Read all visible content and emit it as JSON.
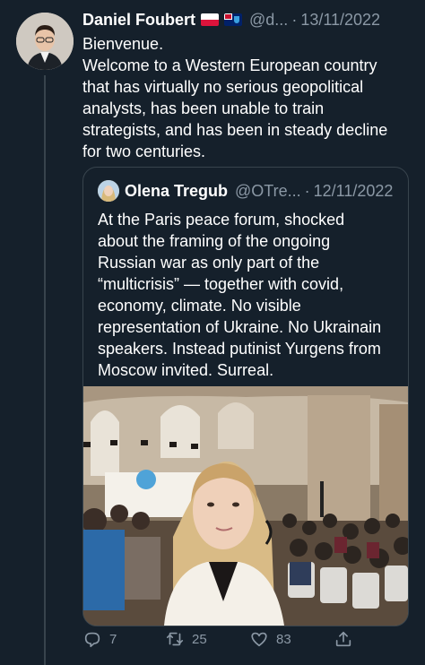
{
  "tweet": {
    "author_name": "Daniel Foubert",
    "author_flags": [
      "flag-poland",
      "flag-falkland-islands"
    ],
    "handle": "@d...",
    "separator": "·",
    "date": "13/11/2022",
    "text": "Bienvenue.\nWelcome to a Western European country\nthat has virtually no serious geopolitical\nanalysts, has been unable to train\nstrategists, and has been in steady decline\nfor two centuries."
  },
  "quoted_tweet": {
    "author_name": "Olena Tregub",
    "handle": "@OTre...",
    "separator": "·",
    "date": "12/11/2022",
    "text": "At the Paris peace forum, shocked\nabout the framing of the ongoing\nRussian war as only part of the\n“multicrisis” — together with covid,\neconomy, climate. No visible\nrepresentation of Ukraine. No Ukrainain\nspeakers. Instead putinist Yurgens from\nMoscow invited. Surreal."
  },
  "actions": {
    "reply": {
      "icon": "reply-icon",
      "count": "7"
    },
    "retweet": {
      "icon": "retweet-icon",
      "count": "25"
    },
    "like": {
      "icon": "heart-icon",
      "count": "83"
    },
    "share": {
      "icon": "share-icon"
    }
  },
  "colors": {
    "background": "#15202b",
    "border": "#38444d",
    "muted_text": "#8b98a5",
    "primary_text": "#ffffff"
  }
}
